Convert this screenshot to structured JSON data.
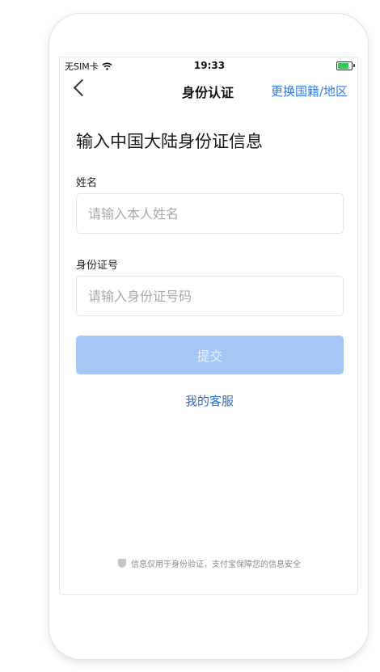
{
  "status_bar": {
    "carrier": "无SIM卡",
    "time": "19:33",
    "wifi_icon": "wifi-icon",
    "battery_icon": "battery-charging-icon"
  },
  "nav": {
    "title": "身份认证",
    "right_link": "更换国籍/地区",
    "back_icon": "back-chevron-icon"
  },
  "form": {
    "heading": "输入中国大陆身份证信息",
    "name_label": "姓名",
    "name_value": "",
    "name_placeholder": "请输入本人姓名",
    "id_label": "身份证号",
    "id_value": "",
    "id_placeholder": "请输入身份证号码",
    "submit_label": "提交",
    "submit_color": "#a6c6f5"
  },
  "service_link": "我的客服",
  "footer": {
    "text": "信息仅用于身份验证，支付宝保障您的信息安全",
    "shield_icon": "shield-icon"
  },
  "colors": {
    "accent": "#2f7ce6"
  }
}
